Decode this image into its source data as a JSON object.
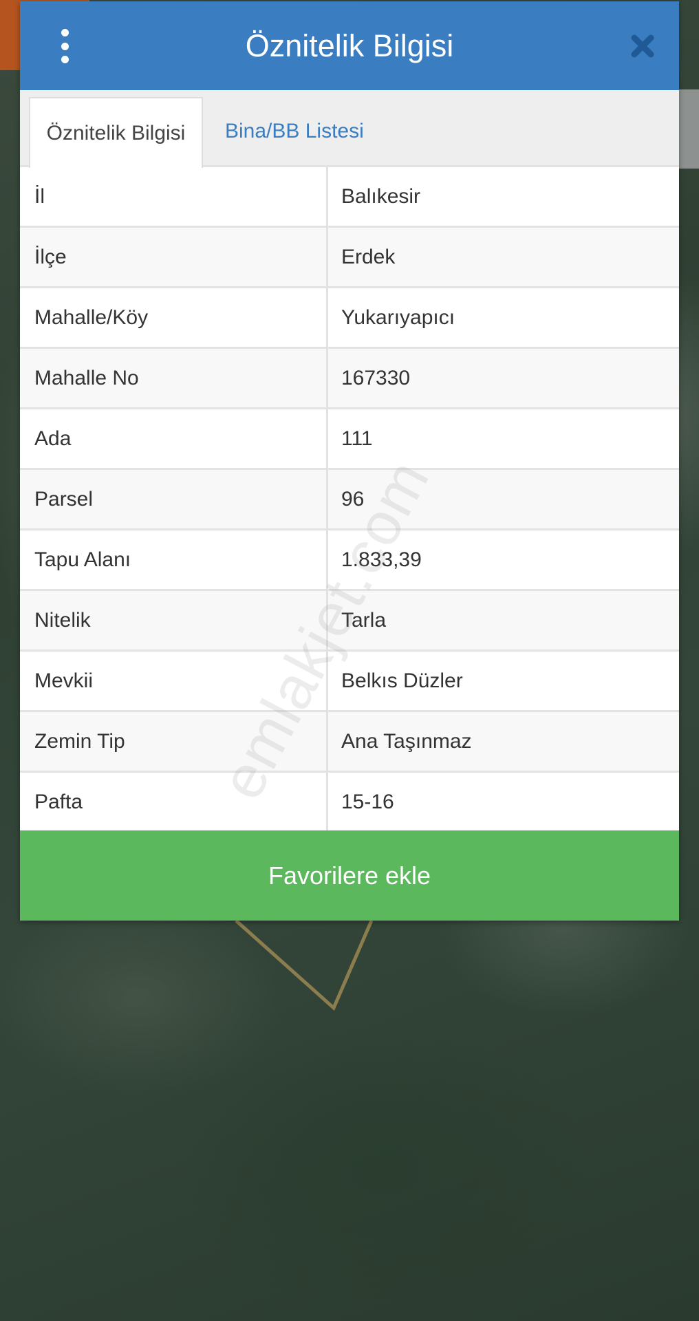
{
  "modal": {
    "title": "Öznitelik Bilgisi"
  },
  "tabs": [
    {
      "label": "Öznitelik Bilgisi",
      "active": true
    },
    {
      "label": "Bina/BB Listesi",
      "active": false
    }
  ],
  "rows": [
    {
      "key": "İl",
      "value": "Balıkesir"
    },
    {
      "key": "İlçe",
      "value": "Erdek"
    },
    {
      "key": "Mahalle/Köy",
      "value": "Yukarıyapıcı"
    },
    {
      "key": "Mahalle No",
      "value": "167330"
    },
    {
      "key": "Ada",
      "value": "111"
    },
    {
      "key": "Parsel",
      "value": "96"
    },
    {
      "key": "Tapu Alanı",
      "value": "1.833,39"
    },
    {
      "key": "Nitelik",
      "value": "Tarla"
    },
    {
      "key": "Mevkii",
      "value": "Belkıs Düzler"
    },
    {
      "key": "Zemin Tip",
      "value": "Ana Taşınmaz"
    },
    {
      "key": "Pafta",
      "value": "15-16"
    }
  ],
  "footer": {
    "favorite_label": "Favorilere ekle"
  },
  "watermark": "emlakjet.com",
  "colors": {
    "header": "#3a7dc0",
    "accent_link": "#3a7dc0",
    "favorite_button": "#5cb85c",
    "parcel_outline": "#8c7d4e"
  },
  "icons": {
    "menu": "vertical-dots-icon",
    "close": "close-x-icon"
  }
}
